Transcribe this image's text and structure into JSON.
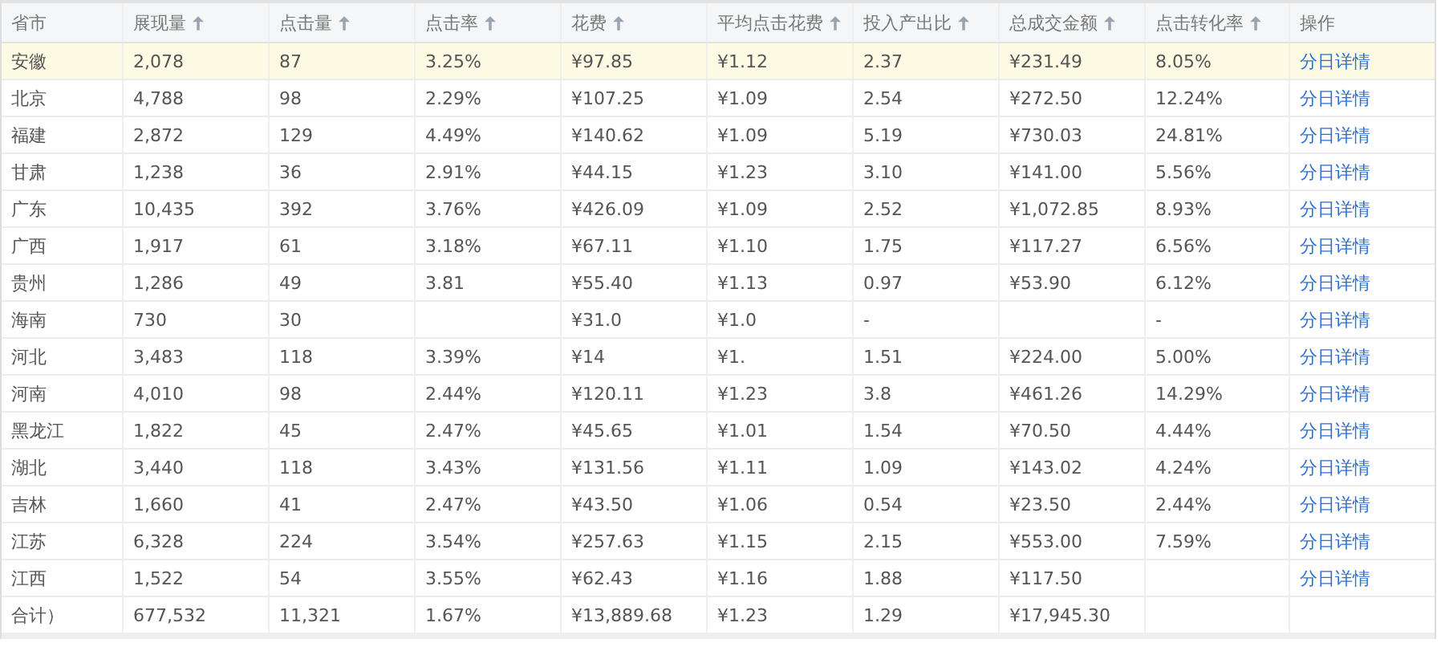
{
  "table": {
    "columns": [
      {
        "label": "省市",
        "sortable": false
      },
      {
        "label": "展现量",
        "sortable": true
      },
      {
        "label": "点击量",
        "sortable": true
      },
      {
        "label": "点击率",
        "sortable": true
      },
      {
        "label": "花费",
        "sortable": true
      },
      {
        "label": "平均点击花费",
        "sortable": true
      },
      {
        "label": "投入产出比",
        "sortable": true
      },
      {
        "label": "总成交金额",
        "sortable": true
      },
      {
        "label": "点击转化率",
        "sortable": true
      },
      {
        "label": "操作",
        "sortable": false
      }
    ],
    "rows": [
      {
        "selected": true,
        "cells": [
          "安徽",
          "2,078",
          "87",
          "3.25%",
          "¥97.85",
          "¥1.12",
          "2.37",
          "¥231.49",
          "8.05%"
        ],
        "action": "分日详情"
      },
      {
        "selected": false,
        "cells": [
          "北京",
          "4,788",
          "98",
          "2.29%",
          "¥107.25",
          "¥1.09",
          "2.54",
          "¥272.50",
          "12.24%"
        ],
        "action": "分日详情"
      },
      {
        "selected": false,
        "cells": [
          "福建",
          "2,872",
          "129",
          "4.49%",
          "¥140.62",
          "¥1.09",
          "5.19",
          "¥730.03",
          "24.81%"
        ],
        "action": "分日详情"
      },
      {
        "selected": false,
        "cells": [
          "甘肃",
          "1,238",
          "36",
          "2.91%",
          "¥44.15",
          "¥1.23",
          "3.10",
          "¥141.00",
          "5.56%"
        ],
        "action": "分日详情"
      },
      {
        "selected": false,
        "cells": [
          "广东",
          "10,435",
          "392",
          "3.76%",
          "¥426.09",
          "¥1.09",
          "2.52",
          "¥1,072.85",
          "8.93%"
        ],
        "action": "分日详情"
      },
      {
        "selected": false,
        "cells": [
          "广西",
          "1,917",
          "61",
          "3.18%",
          "¥67.11",
          "¥1.10",
          "1.75",
          "¥117.27",
          "6.56%"
        ],
        "action": "分日详情"
      },
      {
        "selected": false,
        "cells": [
          "贵州",
          "1,286",
          "49",
          "3.81",
          "¥55.40",
          "¥1.13",
          "0.97",
          "¥53.90",
          "6.12%"
        ],
        "action": "分日详情"
      },
      {
        "selected": false,
        "cells": [
          "海南",
          "730",
          "30",
          null,
          "¥31.0",
          "¥1.0",
          "-",
          null,
          "-"
        ],
        "action": "分日详情"
      },
      {
        "selected": false,
        "cells": [
          "河北",
          "3,483",
          "118",
          "3.39%",
          "¥14",
          "¥1.",
          "1.51",
          "¥224.00",
          "5.00%"
        ],
        "action": "分日详情"
      },
      {
        "selected": false,
        "cells": [
          "河南",
          "4,010",
          "98",
          "2.44%",
          "¥120.11",
          "¥1.23",
          "3.8",
          "¥461.26",
          "14.29%"
        ],
        "action": "分日详情"
      },
      {
        "selected": false,
        "cells": [
          "黑龙江",
          "1,822",
          "45",
          "2.47%",
          "¥45.65",
          "¥1.01",
          "1.54",
          "¥70.50",
          "4.44%"
        ],
        "action": "分日详情"
      },
      {
        "selected": false,
        "cells": [
          "湖北",
          "3,440",
          "118",
          "3.43%",
          "¥131.56",
          "¥1.11",
          "1.09",
          "¥143.02",
          "4.24%"
        ],
        "action": "分日详情"
      },
      {
        "selected": false,
        "cells": [
          "吉林",
          "1,660",
          "41",
          "2.47%",
          "¥43.50",
          "¥1.06",
          "0.54",
          "¥23.50",
          "2.44%"
        ],
        "action": "分日详情"
      },
      {
        "selected": false,
        "cells": [
          "江苏",
          "6,328",
          "224",
          "3.54%",
          "¥257.63",
          "¥1.15",
          "2.15",
          "¥553.00",
          "7.59%"
        ],
        "action": "分日详情"
      },
      {
        "selected": false,
        "cells": [
          "江西",
          "1,522",
          "54",
          "3.55%",
          "¥62.43",
          "¥1.16",
          "1.88",
          "¥117.50",
          null
        ],
        "action": "分日详情"
      }
    ],
    "total_row": {
      "cells": [
        "合计）",
        "677,532",
        "11,321",
        "1.67%",
        "¥13,889.68",
        "¥1.23",
        "1.29",
        "¥17,945.30",
        null
      ]
    }
  }
}
